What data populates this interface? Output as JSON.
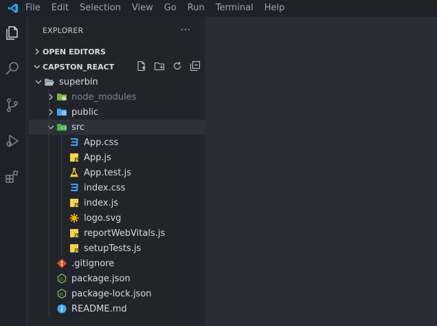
{
  "menu": [
    "File",
    "Edit",
    "Selection",
    "View",
    "Go",
    "Run",
    "Terminal",
    "Help"
  ],
  "explorer": {
    "title": "EXPLORER",
    "more": "···",
    "open_editors": "OPEN EDITORS",
    "project": "CAPSTON_REACT",
    "project_actions": [
      "new-file-icon",
      "new-folder-icon",
      "refresh-icon",
      "collapse-all-icon"
    ]
  },
  "tree": [
    {
      "label": "superbin",
      "indent": 1,
      "kind": "folder-open",
      "twisty": "down"
    },
    {
      "label": "node_modules",
      "indent": 2,
      "kind": "folder-node",
      "twisty": "right",
      "dim": true
    },
    {
      "label": "public",
      "indent": 2,
      "kind": "folder-public",
      "twisty": "right"
    },
    {
      "label": "src",
      "indent": 2,
      "kind": "folder-src",
      "twisty": "down",
      "selected": true
    },
    {
      "label": "App.css",
      "indent": 3,
      "kind": "css"
    },
    {
      "label": "App.js",
      "indent": 3,
      "kind": "js"
    },
    {
      "label": "App.test.js",
      "indent": 3,
      "kind": "test"
    },
    {
      "label": "index.css",
      "indent": 3,
      "kind": "css"
    },
    {
      "label": "index.js",
      "indent": 3,
      "kind": "js"
    },
    {
      "label": "logo.svg",
      "indent": 3,
      "kind": "svg"
    },
    {
      "label": "reportWebVitals.js",
      "indent": 3,
      "kind": "js"
    },
    {
      "label": "setupTests.js",
      "indent": 3,
      "kind": "js"
    },
    {
      "label": ".gitignore",
      "indent": 2,
      "kind": "git"
    },
    {
      "label": "package.json",
      "indent": 2,
      "kind": "node"
    },
    {
      "label": "package-lock.json",
      "indent": 2,
      "kind": "node"
    },
    {
      "label": "README.md",
      "indent": 2,
      "kind": "info"
    }
  ],
  "colors": {
    "accent": "#23a9f2",
    "css": "#42a5f5",
    "js": "#f5d547",
    "node": "#8bc34a",
    "git": "#e44d26",
    "svg": "#ffb300"
  }
}
